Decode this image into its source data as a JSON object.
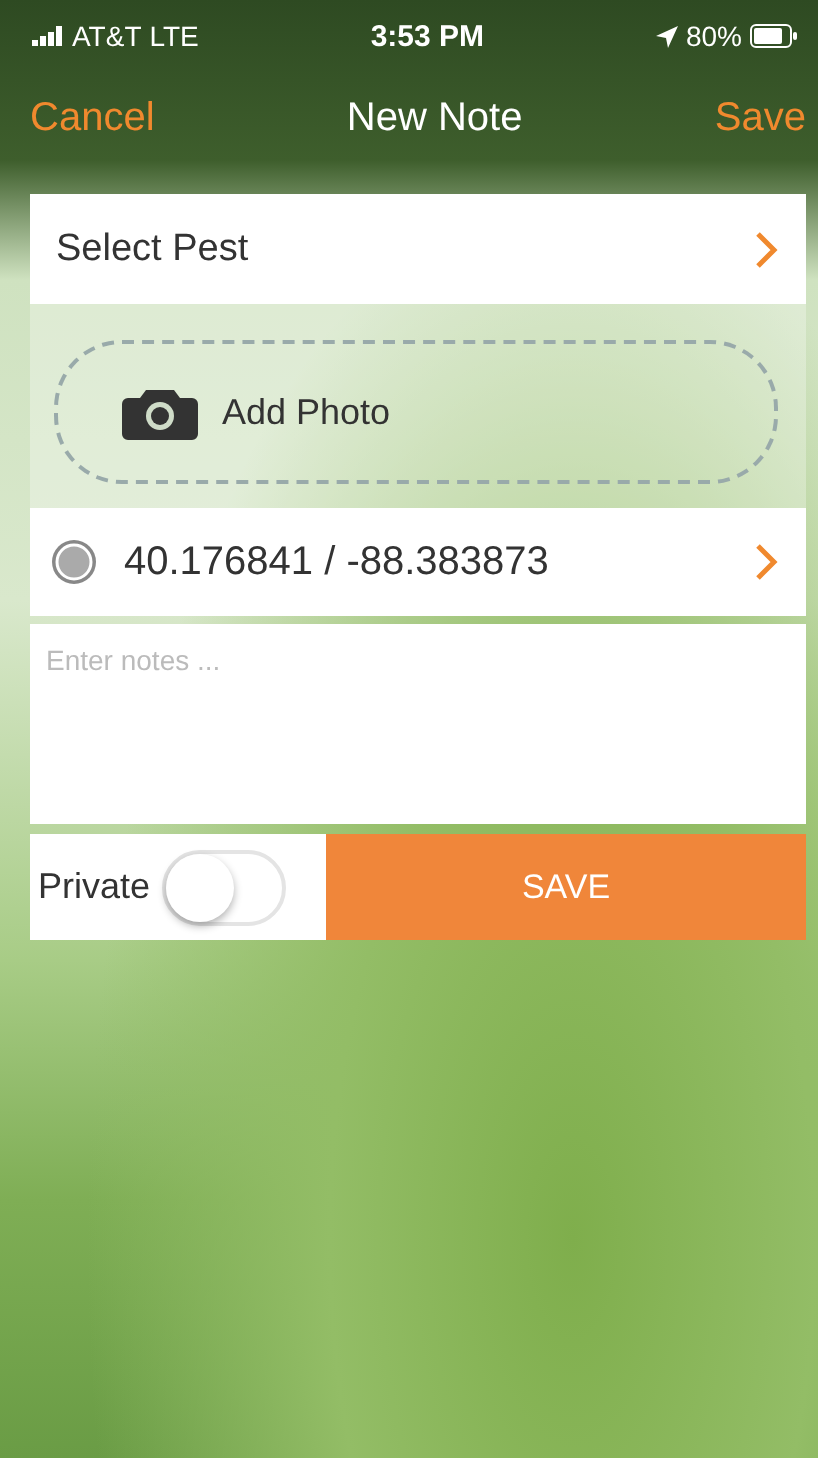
{
  "status_bar": {
    "carrier": "AT&T",
    "network": "LTE",
    "time": "3:53 PM",
    "battery": "80%"
  },
  "nav_bar": {
    "left": "Cancel",
    "title": "New Note",
    "right": "Save"
  },
  "pest_row": {
    "label": "Select Pest"
  },
  "photo": {
    "label": "Add Photo"
  },
  "location_row": {
    "coordinates": "40.176841 / -88.383873"
  },
  "notes": {
    "placeholder": "Enter notes ..."
  },
  "private": {
    "label": "Private",
    "on": false
  },
  "save_button": "SAVE"
}
